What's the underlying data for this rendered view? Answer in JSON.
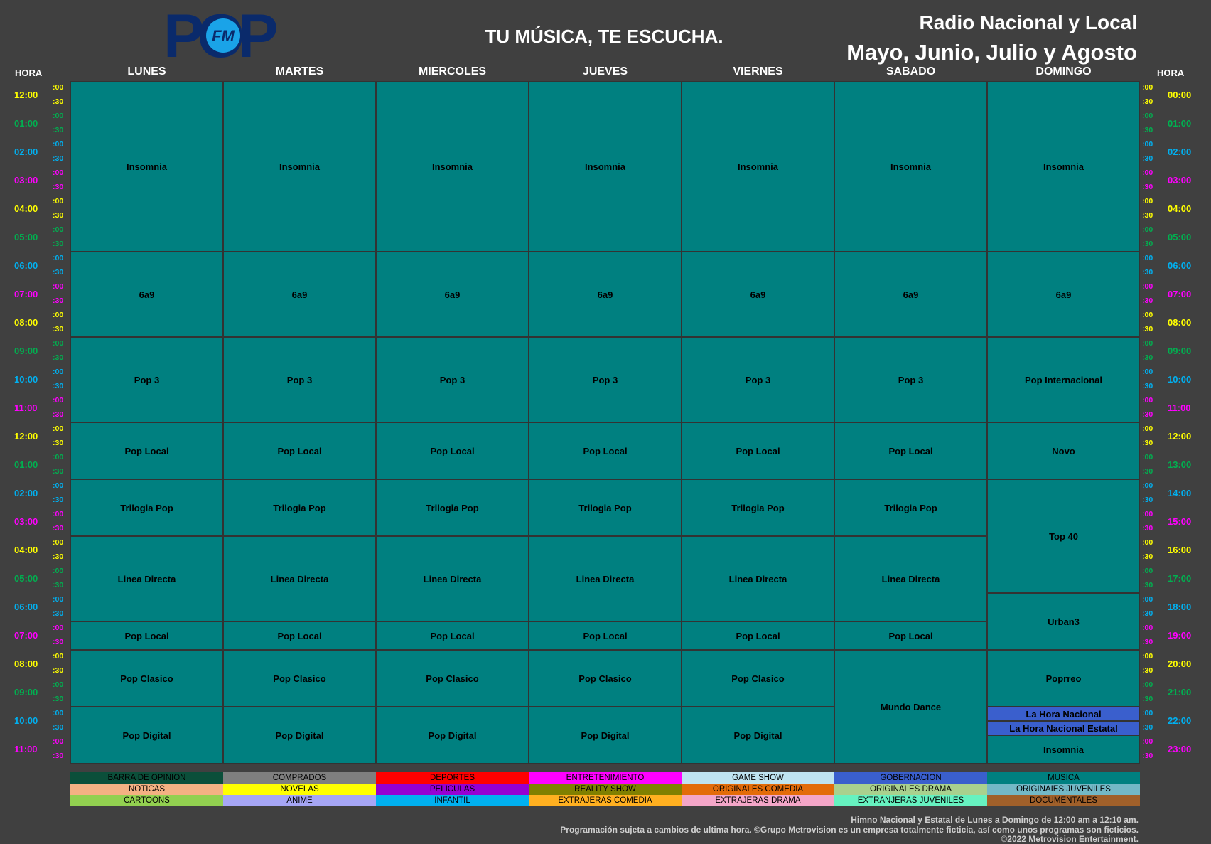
{
  "header": {
    "logo_text": "POP",
    "logo_sub": "FM",
    "slogan": "TU MÚSICA, TE ESCUCHA.",
    "title_line1": "Radio Nacional y Local",
    "title_line2": "Mayo, Junio, Julio y Agosto",
    "hora_left": "HORA",
    "hora_right": "HORA"
  },
  "days": [
    "LUNES",
    "MARTES",
    "MIERCOLES",
    "JUEVES",
    "VIERNES",
    "SABADO",
    "DOMINGO"
  ],
  "hours_left": [
    "12:00",
    "01:00",
    "02:00",
    "03:00",
    "04:00",
    "05:00",
    "06:00",
    "07:00",
    "08:00",
    "09:00",
    "10:00",
    "11:00",
    "12:00",
    "01:00",
    "02:00",
    "03:00",
    "04:00",
    "05:00",
    "06:00",
    "07:00",
    "08:00",
    "09:00",
    "10:00",
    "11:00"
  ],
  "hours_right": [
    "00:00",
    "01:00",
    "02:00",
    "03:00",
    "04:00",
    "05:00",
    "06:00",
    "07:00",
    "08:00",
    "09:00",
    "10:00",
    "11:00",
    "12:00",
    "13:00",
    "14:00",
    "15:00",
    "16:00",
    "17:00",
    "18:00",
    "19:00",
    "20:00",
    "21:00",
    "22:00",
    "23:00"
  ],
  "hour_colors": [
    "#ffff00",
    "#00b050",
    "#00b0f0",
    "#ff00ff"
  ],
  "minute_labels": [
    ":00",
    ":30"
  ],
  "programs": {
    "weekday": [
      {
        "name": "Insomnia",
        "start": 0,
        "end": 12
      },
      {
        "name": "6a9",
        "start": 12,
        "end": 18
      },
      {
        "name": "Pop 3",
        "start": 18,
        "end": 24
      },
      {
        "name": "Pop Local",
        "start": 24,
        "end": 28
      },
      {
        "name": "Trilogia Pop",
        "start": 28,
        "end": 32
      },
      {
        "name": "Linea Directa",
        "start": 32,
        "end": 38
      },
      {
        "name": "Pop Local",
        "start": 38,
        "end": 40
      },
      {
        "name": "Pop Clasico",
        "start": 40,
        "end": 44
      },
      {
        "name": "Pop Digital",
        "start": 44,
        "end": 48
      }
    ],
    "sabado": [
      {
        "name": "Insomnia",
        "start": 0,
        "end": 12
      },
      {
        "name": "6a9",
        "start": 12,
        "end": 18
      },
      {
        "name": "Pop 3",
        "start": 18,
        "end": 24
      },
      {
        "name": "Pop Local",
        "start": 24,
        "end": 28
      },
      {
        "name": "Trilogia Pop",
        "start": 28,
        "end": 32
      },
      {
        "name": "Linea Directa",
        "start": 32,
        "end": 38
      },
      {
        "name": "Pop Local",
        "start": 38,
        "end": 40
      },
      {
        "name": "Mundo Dance",
        "start": 40,
        "end": 48
      }
    ],
    "domingo": [
      {
        "name": "Insomnia",
        "start": 0,
        "end": 12
      },
      {
        "name": "6a9",
        "start": 12,
        "end": 18
      },
      {
        "name": "Pop Internacional",
        "start": 18,
        "end": 24
      },
      {
        "name": "Novo",
        "start": 24,
        "end": 28
      },
      {
        "name": "Top 40",
        "start": 28,
        "end": 36
      },
      {
        "name": "Urban3",
        "start": 36,
        "end": 40
      },
      {
        "name": "Poprreo",
        "start": 40,
        "end": 44
      },
      {
        "name": "La Hora Nacional",
        "start": 44,
        "end": 45,
        "gob": true
      },
      {
        "name": "La Hora Nacional Estatal",
        "start": 45,
        "end": 46,
        "gob": true
      },
      {
        "name": "Insomnia",
        "start": 46,
        "end": 48
      }
    ]
  },
  "legend": [
    [
      {
        "label": "BARRA DE OPINION",
        "color": "#0b4f3a"
      },
      {
        "label": "COMPRADOS",
        "color": "#7f7f7f"
      },
      {
        "label": "DEPORTES",
        "color": "#ff0000"
      },
      {
        "label": "ENTRETENIMIENTO",
        "color": "#ff00ff"
      },
      {
        "label": "GAME SHOW",
        "color": "#bfe3f0"
      },
      {
        "label": "GOBERNACION",
        "color": "#3a5fcd"
      },
      {
        "label": "MUSICA",
        "color": "#008080"
      }
    ],
    [
      {
        "label": "NOTICAS",
        "color": "#f4b183"
      },
      {
        "label": "NOVELAS",
        "color": "#ffff00"
      },
      {
        "label": "PELICULAS",
        "color": "#9400d3"
      },
      {
        "label": "REALITY SHOW",
        "color": "#808000"
      },
      {
        "label": "ORIGINALES COMEDIA",
        "color": "#e36c09"
      },
      {
        "label": "ORIGINALES DRAMA",
        "color": "#a9d18e"
      },
      {
        "label": "ORIGINAIES JUVENILES",
        "color": "#73b8c6"
      }
    ],
    [
      {
        "label": "CARTOONS",
        "color": "#92d050"
      },
      {
        "label": "ANIME",
        "color": "#a6a6f5"
      },
      {
        "label": "INFANTIL",
        "color": "#00b0f0"
      },
      {
        "label": "EXTRAJERAS COMEDIA",
        "color": "#ffb020"
      },
      {
        "label": "EXTRAJERAS DRAMA",
        "color": "#f4a6c8"
      },
      {
        "label": "EXTRANJERAS JUVENILES",
        "color": "#66f2c0"
      },
      {
        "label": "DOCUMENTALES",
        "color": "#a0602a"
      }
    ]
  ],
  "footer": {
    "line1": "Himno Nacional y Estatal de Lunes a Domingo de 12:00 am a 12:10 am.",
    "line2": "Programación sujeta a cambios de ultima hora. ©Grupo Metrovision es un empresa totalmente ficticia, así como unos programas son ficticios.",
    "line3": "©2022 Metrovision Entertainment."
  }
}
